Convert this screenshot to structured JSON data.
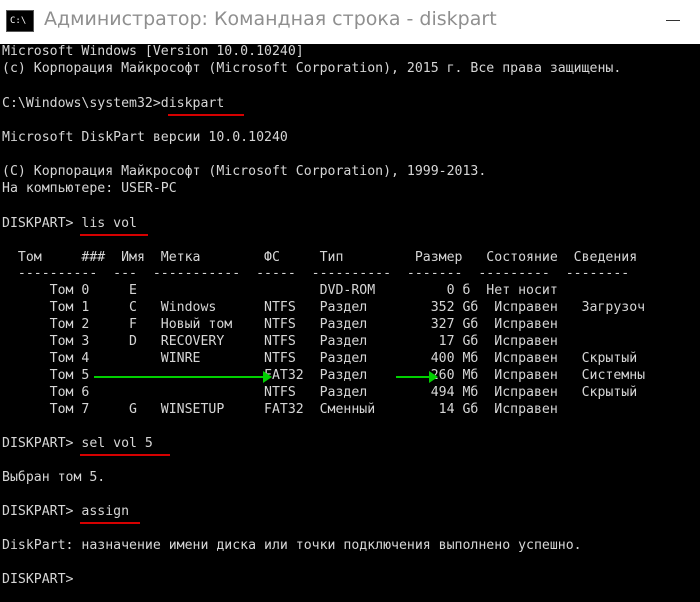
{
  "window": {
    "title": "Администратор: Командная строка - diskpart",
    "icon_label": "C:\\"
  },
  "console": {
    "lines": [
      "Microsoft Windows [Version 10.0.10240]",
      "(c) Корпорация Майкрософт (Microsoft Corporation), 2015 г. Все права защищены.",
      "C:\\Windows\\system32>diskpart",
      "Microsoft DiskPart версии 10.0.10240",
      "(C) Корпорация Майкрософт (Microsoft Corporation), 1999-2013.",
      "На компьютере: USER-PC",
      "DISKPART> lis vol",
      "  Том     ###  Имя  Метка        ФС     Тип         Размер   Состояние  Сведения",
      "  ----------  ---  -----------  -----  ----------  -------  ---------  --------",
      "      Том 0     E                       DVD-ROM         0 б  Нет носит",
      "      Том 1     C   Windows      NTFS   Раздел        352 Gб  Исправен   Загрузоч",
      "      Том 2     F   Новый том    NTFS   Раздел        327 Gб  Исправен",
      "      Том 3     D   RECOVERY     NTFS   Раздел         17 Gб  Исправен",
      "      Том 4         WINRE        NTFS   Раздел        400 Мб  Исправен   Скрытый",
      "      Том 5                      FAT32  Раздел        260 Мб  Исправен   Системны",
      "      Том 6                      NTFS   Раздел        494 Мб  Исправен   Скрытый",
      "      Том 7     G   WINSETUP     FAT32  Сменный        14 Gб  Исправен",
      "DISKPART> sel vol 5",
      "Выбран том 5.",
      "DISKPART> assign",
      "DiskPart: назначение имени диска или точки подключения выполнено успешно.",
      "DISKPART>"
    ]
  },
  "colors": {
    "console_bg": "#000000",
    "console_text": "#d6d6d6",
    "underline": "#d60000",
    "arrow": "#00d000"
  }
}
